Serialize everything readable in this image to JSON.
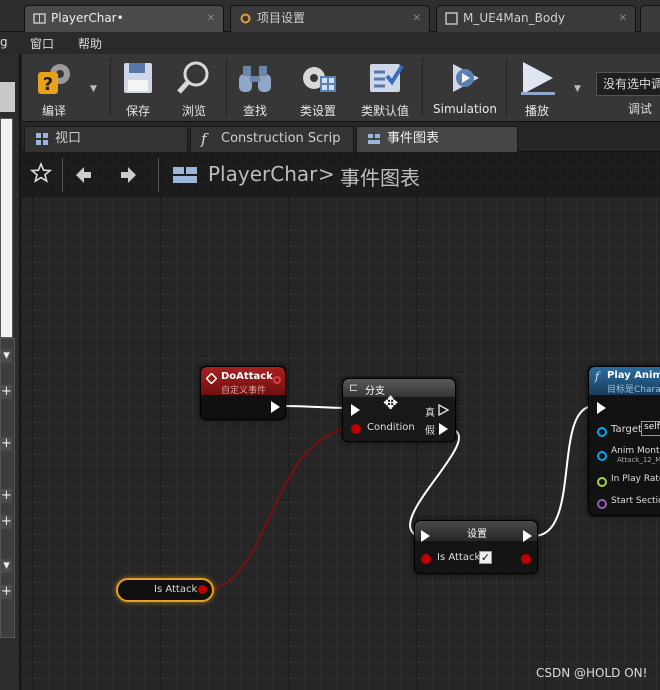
{
  "document_tabs": [
    {
      "label": "PlayerChar",
      "modified": "•",
      "active": true
    },
    {
      "label": "项目设置",
      "active": false
    },
    {
      "label": "M_UE4Man_Body",
      "active": false
    }
  ],
  "menu": {
    "items": [
      "g",
      "窗口",
      "帮助"
    ]
  },
  "toolbar": {
    "buttons": [
      {
        "label": "编译",
        "icon": "compile-icon"
      },
      {
        "label": "保存",
        "icon": "save-icon"
      },
      {
        "label": "浏览",
        "icon": "browse-icon"
      },
      {
        "label": "查找",
        "icon": "find-icon"
      },
      {
        "label": "类设置",
        "icon": "class-settings-icon"
      },
      {
        "label": "类默认值",
        "icon": "class-defaults-icon"
      },
      {
        "label": "Simulation",
        "icon": "simulation-icon"
      },
      {
        "label": "播放",
        "icon": "play-icon"
      }
    ],
    "debug_filter": "没有选中调",
    "debug_label": "调试"
  },
  "subtabs": [
    {
      "label": "视口",
      "active": false
    },
    {
      "label": "Construction Scrip",
      "active": false
    },
    {
      "label": "事件图表",
      "active": true
    }
  ],
  "graph_nav": {
    "crumb_root": "PlayerChar",
    "separator": ">",
    "crumb_current": "事件图表"
  },
  "nodes": {
    "doattack": {
      "title": "DoAttack",
      "subtitle": "自定义事件"
    },
    "branch": {
      "title": "分支",
      "pin_true": "真",
      "pin_false": "假",
      "pin_condition": "Condition"
    },
    "set": {
      "title": "设置",
      "pin_var": "Is Attack",
      "checked": true
    },
    "is_attack_var": {
      "label": "Is Attack"
    },
    "play_anim": {
      "title": "Play Anim M",
      "subtitle": "目标是Chara",
      "pins": [
        {
          "label": "Target",
          "value": "self"
        },
        {
          "label": "Anim Monta",
          "value": "Attack_12_M"
        },
        {
          "label": "In Play Rate",
          "value": ""
        },
        {
          "label": "Start Section",
          "value": ""
        }
      ]
    }
  },
  "colors": {
    "exec": "#ffffff",
    "bool": "#8c0000",
    "object": "#00a8f4",
    "float": "#a4d44c",
    "name": "#9b5cbf",
    "event_header": "#8b1a1a",
    "function_header": "#1f5f8f"
  },
  "watermark": "CSDN @HOLD ON!"
}
